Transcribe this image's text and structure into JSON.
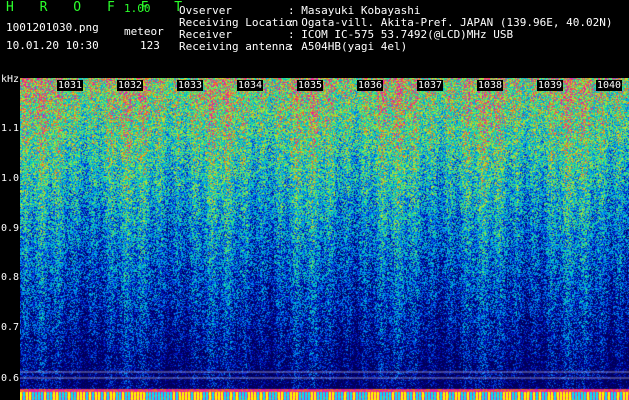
{
  "app": {
    "name": "H R O F F T",
    "version": "1.00"
  },
  "file": {
    "name": "1001201030.png",
    "datetime": "10.01.20 10:30"
  },
  "meteor": {
    "label": "meteor",
    "count": "123"
  },
  "info": [
    {
      "label": "Ovserver",
      "value": ": Masayuki Kobayashi"
    },
    {
      "label": "Receiving Location",
      "value": ": Ogata-vill. Akita-Pref. JAPAN (139.96E, 40.02N)"
    },
    {
      "label": "Receiver",
      "value": ": ICOM IC-575 53.7492(@LCD)MHz USB"
    },
    {
      "label": "Receiving antenna",
      "value": ": A504HB(yagi 4el)"
    }
  ],
  "axis": {
    "y_unit": "kHz",
    "y_ticks": [
      "1.1",
      "1.0",
      "0.9",
      "0.8",
      "0.7",
      "0.6"
    ],
    "x_ticks": [
      "1031",
      "1032",
      "1033",
      "1034",
      "1035",
      "1036",
      "1037",
      "1038",
      "1039",
      "1040"
    ]
  },
  "colors": {
    "title": "#2bff2b",
    "text": "#ffffff",
    "background": "#000000"
  }
}
